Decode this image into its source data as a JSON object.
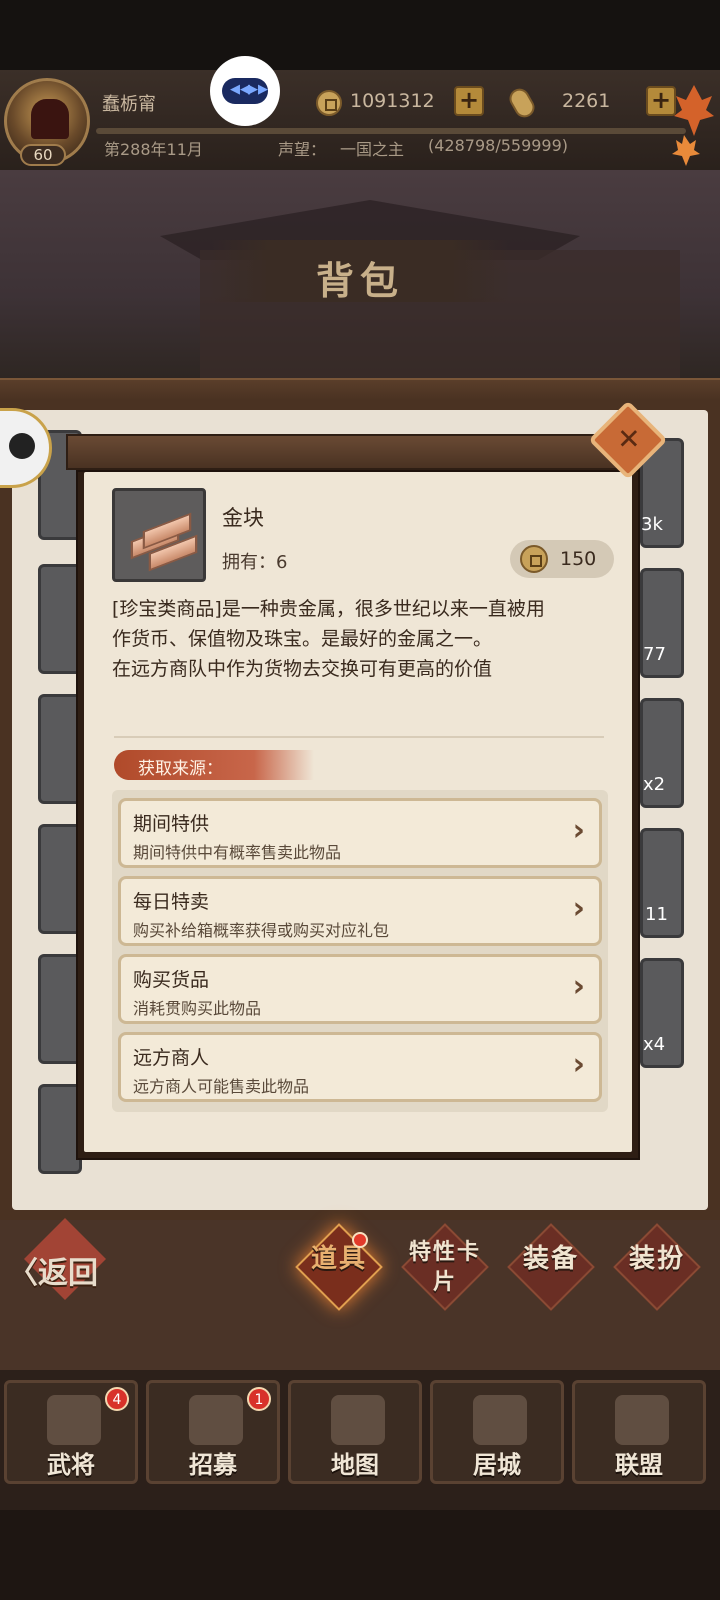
{
  "header": {
    "player_name": "蠢栃甯",
    "level": "60",
    "date": "第288年11月",
    "reputation_label": "声望：",
    "reputation_value": "一国之主",
    "reputation_progress": "(428798/559999)",
    "coins": "1091312",
    "ingots": "2261",
    "plus_label": "+"
  },
  "page": {
    "title": "背包"
  },
  "background_slots": {
    "right_counts": [
      "3k",
      "77",
      "x2",
      "11",
      "x4"
    ]
  },
  "item": {
    "name": "金块",
    "owned": "拥有：6",
    "price": "150",
    "description": [
      "[珍宝类商品]是一种贵金属，很多世纪以来一直被用",
      "作货币、保值物及珠宝。是最好的金属之一。",
      "在远方商队中作为货物去交换可有更高的价值"
    ],
    "source_title": "获取来源：",
    "sources": [
      {
        "title": "期间特供",
        "subtitle": "期间特供中有概率售卖此物品"
      },
      {
        "title": "每日特卖",
        "subtitle": "购买补给箱概率获得或购买对应礼包"
      },
      {
        "title": "购买货品",
        "subtitle": "消耗贯购买此物品"
      },
      {
        "title": "远方商人",
        "subtitle": "远方商人可能售卖此物品"
      }
    ]
  },
  "tabs": {
    "back": "〈返回",
    "items": [
      {
        "label": "道具",
        "active": true
      },
      {
        "label": "特性卡片",
        "active": false
      },
      {
        "label": "装备",
        "active": false
      },
      {
        "label": "装扮",
        "active": false
      }
    ]
  },
  "nav": [
    {
      "label": "武将",
      "badge": "4"
    },
    {
      "label": "招募",
      "badge": "1"
    },
    {
      "label": "地图",
      "badge": ""
    },
    {
      "label": "居城",
      "badge": ""
    },
    {
      "label": "联盟",
      "badge": ""
    }
  ],
  "colors": {
    "accent": "#c86a36",
    "panel": "#efe6d6",
    "badge_red": "#d8322a"
  }
}
